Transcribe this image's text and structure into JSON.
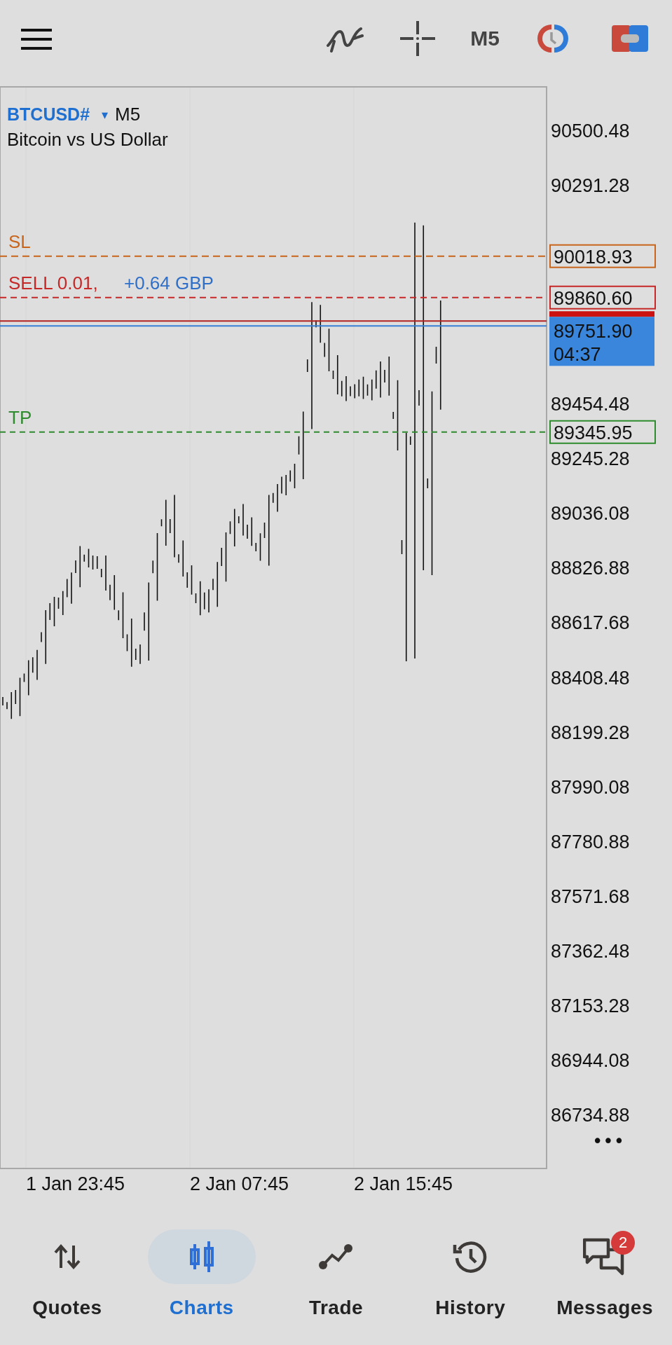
{
  "toolbar": {
    "timeframe": "M5"
  },
  "chart": {
    "symbol": "BTCUSD#",
    "caret": "▾",
    "timeframe": "M5",
    "description": "Bitcoin vs US Dollar",
    "levels": [
      {
        "kind": "sl",
        "label": "SL",
        "price": "90018.93",
        "color": "#c8651b"
      },
      {
        "kind": "sell",
        "label": "SELL 0.01,",
        "profit": "+0.64 GBP",
        "price": "89860.60",
        "color": "#c62828"
      },
      {
        "kind": "tp",
        "label": "TP",
        "price": "89345.95",
        "color": "#2e8b2e"
      }
    ],
    "bid": {
      "price": "89751.90",
      "countdown": "04:37"
    },
    "more": "•••",
    "price_axis": [
      "90500.48",
      "90291.28",
      "89454.48",
      "89245.28",
      "89036.08",
      "88826.88",
      "88617.68",
      "88408.48",
      "88199.28",
      "87990.08",
      "87780.88",
      "87571.68",
      "87362.48",
      "87153.28",
      "86944.08",
      "86734.88"
    ],
    "time_axis": [
      "1 Jan 23:45",
      "2 Jan 07:45",
      "2 Jan 15:45"
    ]
  },
  "nav": [
    {
      "kind": "quotes",
      "label": "Quotes",
      "selected": false
    },
    {
      "kind": "charts",
      "label": "Charts",
      "selected": true
    },
    {
      "kind": "trade",
      "label": "Trade",
      "selected": false
    },
    {
      "kind": "history",
      "label": "History",
      "selected": false
    },
    {
      "kind": "messages",
      "label": "Messages",
      "selected": false,
      "badge": "2"
    }
  ]
}
